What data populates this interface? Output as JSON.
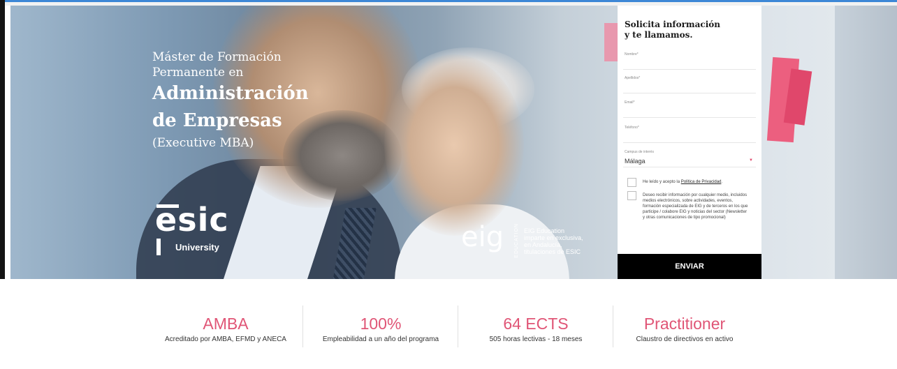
{
  "hero": {
    "line1": "Máster de Formación",
    "line2": "Permanente en",
    "line3": "Administración",
    "line4": "de Empresas",
    "line5": "(Executive MBA)"
  },
  "esic": {
    "word": "esic",
    "sub": "University"
  },
  "eig": {
    "word": "eig",
    "edu": "EDUCATION",
    "note1": "EIG Education",
    "note2": "imparte en exclusiva,",
    "note3": "en Andalucía,",
    "note4": "titulaciones de ESIC"
  },
  "form": {
    "title1": "Solicita información",
    "title2": "y te llamamos.",
    "nombre_label": "Nombre*",
    "apellidos_label": "Apellidos*",
    "email_label": "Email*",
    "telefono_label": "Teléfono*",
    "campus_label": "Campus de interés",
    "campus_value": "Málaga",
    "privacy_text": "He leído y acepto la",
    "privacy_link": "Política de Privacidad",
    "privacy_end": ".",
    "consent_text": "Deseo recibir información por cualquier medio, incluidos medios electrónicos, sobre actividades, eventos, formación especializada de EIG y de terceros en los que participe / colabore EIG y noticias del sector (Newsletter y otras comunicaciones de tipo promocional)",
    "submit": "ENVIAR"
  },
  "stats": [
    {
      "value": "AMBA",
      "desc": "Acreditado por AMBA, EFMD y ANECA"
    },
    {
      "value": "100%",
      "desc": "Empleabilidad a un año del programa"
    },
    {
      "value": "64 ECTS",
      "desc": "505 horas lectivas - 18 meses"
    },
    {
      "value": "Practitioner",
      "desc": "Claustro de directivos en activo"
    }
  ],
  "colors": {
    "accent": "#e05576",
    "form_button": "#000000",
    "top_line": "#3d87d6"
  }
}
